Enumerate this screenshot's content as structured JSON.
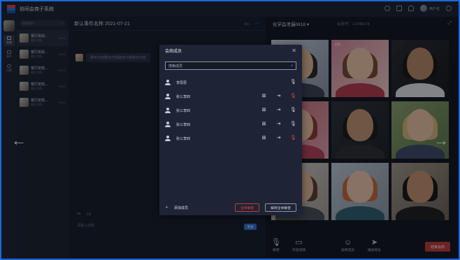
{
  "app": {
    "title": "协同会商子系统",
    "username": "用户名"
  },
  "search": {
    "placeholder": "搜索用户"
  },
  "rail": [
    {
      "label": "会商",
      "active": true
    },
    {
      "label": "事件",
      "active": false
    },
    {
      "label": "设置",
      "active": false
    }
  ],
  "chats": [
    {
      "title": "银行抢劫...",
      "sub": "最后消息...",
      "time": "09:21",
      "selected": true
    },
    {
      "title": "银行抢劫...",
      "sub": "最后消息...",
      "time": "09:21",
      "selected": false
    },
    {
      "title": "银行抢劫...",
      "sub": "最后消息...",
      "time": "09:21",
      "selected": false
    },
    {
      "title": "银行抢劫...",
      "sub": "最后消息...",
      "time": "09:21",
      "selected": false
    },
    {
      "title": "银行抢劫...",
      "sub": "最后消息...",
      "time": "09:21",
      "selected": false
    }
  ],
  "conversation": {
    "title": "新认事件名称 2021-07-21",
    "message": "聊天内容聊天内容聊天内容聊天内容",
    "input_placeholder": "请输入消息",
    "send_label": "发送"
  },
  "video": {
    "title": "化学品泄漏0618 ▾",
    "meeting_no": "会商号：12345678",
    "tile_label": "主持"
  },
  "bottombar": {
    "mute": "静音",
    "video": "开启视频",
    "members": "会商成员",
    "share": "推送地址",
    "end": "结束会商"
  },
  "modal": {
    "title": "会商成员",
    "search_placeholder": "搜索成员",
    "host": {
      "name": "李思思"
    },
    "members": [
      {
        "name": "张三李四",
        "mic_muted": true
      },
      {
        "name": "张三李四",
        "mic_muted": false
      },
      {
        "name": "张三李四",
        "mic_muted": false
      },
      {
        "name": "张三李四",
        "mic_muted": true
      }
    ],
    "add_member": "添加成员",
    "mute_all": "全体静音",
    "unmute_all": "解除全体静音"
  },
  "colors": {
    "accent": "#2f6fd9",
    "danger": "#c23a36",
    "frame": "#1a6ad8"
  }
}
